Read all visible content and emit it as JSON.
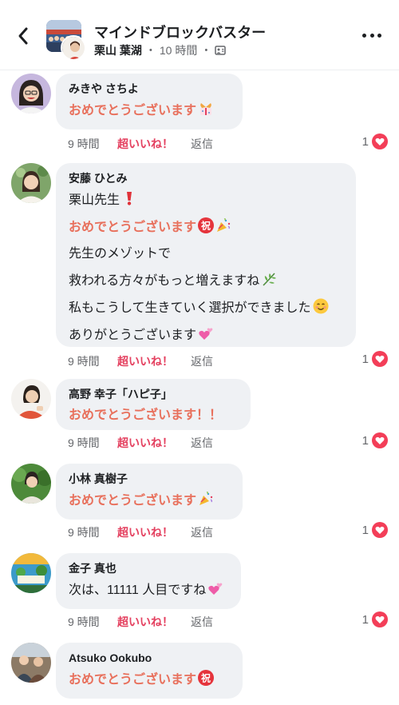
{
  "header": {
    "group_name": "マインドブロックバスター",
    "author": "栗山 葉湖",
    "time": "10 時間",
    "separator": "・",
    "back_icon": "chevron-left-icon",
    "more_icon": "more-horizontal-icon",
    "privacy_icon": "group-members-icon"
  },
  "action_labels": {
    "like": "超いいね！",
    "reply": "返信"
  },
  "colors": {
    "accent_text": "#e8705c",
    "like": "#e4405f",
    "bubble": "#eff1f4",
    "meta": "#65676b"
  },
  "comments": [
    {
      "name": "みきや さちよ",
      "lines": [
        "おめでとうございます"
      ],
      "line_emojis": [
        "ribbon-gift-icon"
      ],
      "time": "9 時間",
      "reaction_count": "1"
    },
    {
      "name": "安藤 ひとみ",
      "lines": [
        "栗山先生",
        "おめでとうございます",
        "先生のメゾットで",
        "救われる方々がもっと増えますね",
        "私もこうして生きていく選択ができました",
        "ありがとうございます"
      ],
      "line_emojis": [
        "red-exclamation-icon",
        "congratulations-party-icon",
        "",
        "herb-icon",
        "smiley-face-icon",
        "two-hearts-icon"
      ],
      "time": "9 時間",
      "reaction_count": "1"
    },
    {
      "name": "高野 幸子「ハピ子」",
      "lines": [
        "おめでとうございます！！"
      ],
      "line_emojis": [
        ""
      ],
      "time": "9 時間",
      "reaction_count": "1"
    },
    {
      "name": "小林 真樹子",
      "lines": [
        "おめでとうございます"
      ],
      "line_emojis": [
        "party-popper-icon"
      ],
      "time": "9 時間",
      "reaction_count": "1"
    },
    {
      "name": "金子 真也",
      "lines": [
        "次は、11111 人目ですね"
      ],
      "line_emojis": [
        "two-hearts-icon"
      ],
      "time": "9 時間",
      "reaction_count": "1"
    },
    {
      "name": "Atsuko Ookubo",
      "lines": [
        "おめでとうございます"
      ],
      "line_emojis": [
        "congratulations-icon"
      ],
      "time": "",
      "reaction_count": ""
    }
  ]
}
